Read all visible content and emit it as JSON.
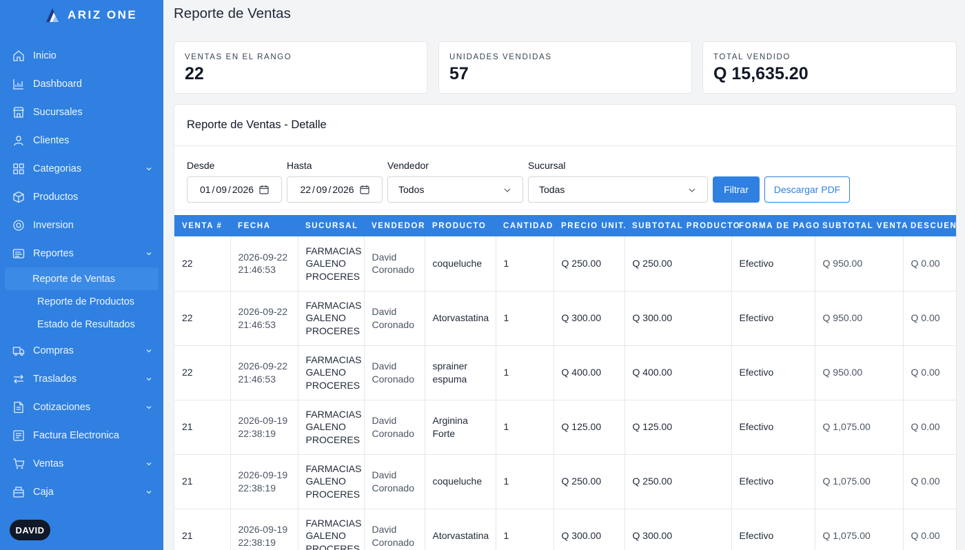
{
  "app": {
    "name": "ARIZ ONE",
    "user": "DAVID"
  },
  "sidebar": {
    "items": [
      {
        "label": "Inicio",
        "icon": "home-icon",
        "chevron": false
      },
      {
        "label": "Dashboard",
        "icon": "chart-icon",
        "chevron": false
      },
      {
        "label": "Sucursales",
        "icon": "store-icon",
        "chevron": false
      },
      {
        "label": "Clientes",
        "icon": "users-icon",
        "chevron": false
      },
      {
        "label": "Categorias",
        "icon": "grid-icon",
        "chevron": true
      },
      {
        "label": "Productos",
        "icon": "cube-icon",
        "chevron": false
      },
      {
        "label": "Inversion",
        "icon": "coin-icon",
        "chevron": false
      },
      {
        "label": "Reportes",
        "icon": "report-icon",
        "chevron": true,
        "expanded": true
      }
    ],
    "subitems": [
      {
        "label": "Reporte de Ventas",
        "active": true
      },
      {
        "label": "Reporte de Productos",
        "active": false
      },
      {
        "label": "Estado de Resultados",
        "active": false
      }
    ],
    "items_after": [
      {
        "label": "Compras",
        "icon": "truck-icon",
        "chevron": true
      },
      {
        "label": "Traslados",
        "icon": "transfer-icon",
        "chevron": true
      },
      {
        "label": "Cotizaciones",
        "icon": "document-icon",
        "chevron": true
      },
      {
        "label": "Factura Electronica",
        "icon": "invoice-icon",
        "chevron": false
      },
      {
        "label": "Ventas",
        "icon": "cart-icon",
        "chevron": true
      },
      {
        "label": "Caja",
        "icon": "cashbox-icon",
        "chevron": true
      }
    ]
  },
  "page": {
    "title": "Reporte de Ventas"
  },
  "stats": [
    {
      "caption": "Ventas en el rango",
      "value": "22"
    },
    {
      "caption": "Unidades vendidas",
      "value": "57"
    },
    {
      "caption": "Total vendido",
      "value": "Q 15,635.20"
    }
  ],
  "panel": {
    "title": "Reporte de Ventas - Detalle"
  },
  "filters": {
    "desde_label": "Desde",
    "desde": {
      "d": "01",
      "m": "09",
      "y": "2026"
    },
    "hasta_label": "Hasta",
    "hasta": {
      "d": "22",
      "m": "09",
      "y": "2026"
    },
    "vendedor_label": "Vendedor",
    "vendedor": "Todos",
    "sucursal_label": "Sucursal",
    "sucursal": "Todas",
    "filter_button": "Filtrar",
    "pdf_button": "Descargar PDF"
  },
  "table": {
    "headers": [
      "Venta #",
      "Fecha",
      "Sucursal",
      "Vendedor",
      "Producto",
      "Cantidad",
      "Precio Unit.",
      "Subtotal Producto",
      "Forma de Pago",
      "Subtotal Venta",
      "Descuento"
    ],
    "rows": [
      [
        "22",
        "2026-09-22 21:46:53",
        "FARMACIAS GALENO PROCERES",
        "David Coronado",
        "coqueluche",
        "1",
        "Q 250.00",
        "Q 250.00",
        "Efectivo",
        "Q 950.00",
        "Q 0.00"
      ],
      [
        "22",
        "2026-09-22 21:46:53",
        "FARMACIAS GALENO PROCERES",
        "David Coronado",
        "Atorvastatina",
        "1",
        "Q 300.00",
        "Q 300.00",
        "Efectivo",
        "Q 950.00",
        "Q 0.00"
      ],
      [
        "22",
        "2026-09-22 21:46:53",
        "FARMACIAS GALENO PROCERES",
        "David Coronado",
        "sprainer espuma",
        "1",
        "Q 400.00",
        "Q 400.00",
        "Efectivo",
        "Q 950.00",
        "Q 0.00"
      ],
      [
        "21",
        "2026-09-19 22:38:19",
        "FARMACIAS GALENO PROCERES",
        "David Coronado",
        "Arginina Forte",
        "1",
        "Q 125.00",
        "Q 125.00",
        "Efectivo",
        "Q 1,075.00",
        "Q 0.00"
      ],
      [
        "21",
        "2026-09-19 22:38:19",
        "FARMACIAS GALENO PROCERES",
        "David Coronado",
        "coqueluche",
        "1",
        "Q 250.00",
        "Q 250.00",
        "Efectivo",
        "Q 1,075.00",
        "Q 0.00"
      ],
      [
        "21",
        "2026-09-19 22:38:19",
        "FARMACIAS GALENO PROCERES",
        "David Coronado",
        "Atorvastatina",
        "1",
        "Q 300.00",
        "Q 300.00",
        "Efectivo",
        "Q 1,075.00",
        "Q 0.00"
      ]
    ]
  },
  "colors": {
    "primary": "#2f80e0",
    "sidebar": "#2f80e0",
    "badge": "#111827"
  }
}
